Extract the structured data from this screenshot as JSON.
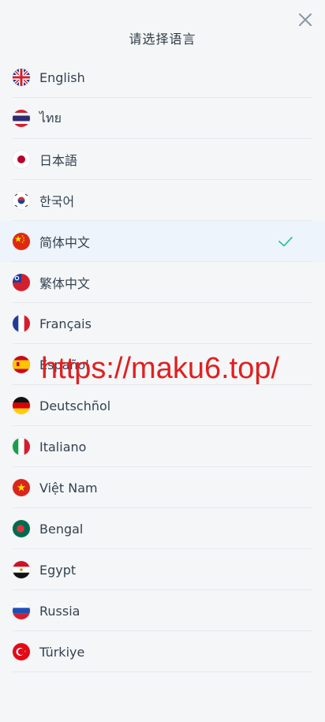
{
  "header": {
    "title": "请选择语言"
  },
  "accent_color": "#2bc4a8",
  "languages": [
    {
      "label": "English",
      "flag": "uk-flag-icon"
    },
    {
      "label": "ไทย",
      "flag": "thailand-flag-icon"
    },
    {
      "label": "日本語",
      "flag": "japan-flag-icon"
    },
    {
      "label": "한국어",
      "flag": "korea-flag-icon"
    },
    {
      "label": "简体中文",
      "flag": "china-flag-icon",
      "selected": true
    },
    {
      "label": "繁体中文",
      "flag": "taiwan-flag-icon"
    },
    {
      "label": "Français",
      "flag": "france-flag-icon"
    },
    {
      "label": "Español",
      "flag": "spain-flag-icon"
    },
    {
      "label": "Deutschñol",
      "flag": "germany-flag-icon"
    },
    {
      "label": "Italiano",
      "flag": "italy-flag-icon"
    },
    {
      "label": "Việt Nam",
      "flag": "vietnam-flag-icon"
    },
    {
      "label": "Bengal",
      "flag": "bangladesh-flag-icon"
    },
    {
      "label": "Egypt",
      "flag": "egypt-flag-icon"
    },
    {
      "label": "Russia",
      "flag": "russia-flag-icon"
    },
    {
      "label": "Türkiye",
      "flag": "turkey-flag-icon"
    }
  ],
  "watermark": {
    "text": "https://maku6.top/"
  }
}
